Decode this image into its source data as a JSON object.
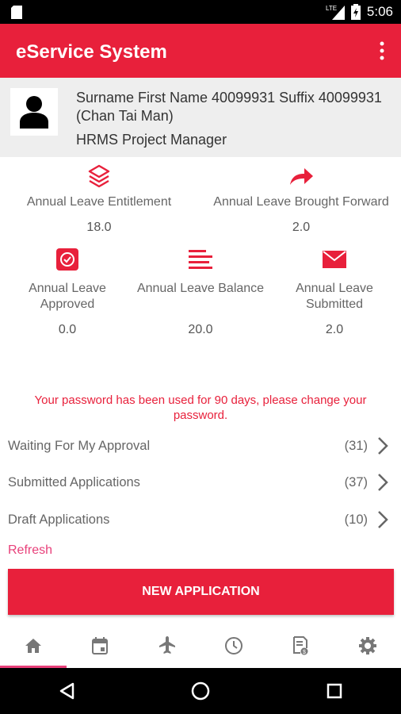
{
  "status_bar": {
    "time": "5:06",
    "network": "LTE"
  },
  "app_bar": {
    "title": "eService System"
  },
  "profile": {
    "name": "Surname First Name 40099931 Suffix 40099931 (Chan Tai Man)",
    "title": "HRMS Project Manager"
  },
  "stats": [
    {
      "label": "Annual Leave Entitlement",
      "value": "18.0",
      "icon": "layers-icon"
    },
    {
      "label": "Annual Leave Brought Forward",
      "value": "2.0",
      "icon": "forward-arrow-icon"
    },
    {
      "label": "Annual Leave Approved",
      "value": "0.0",
      "icon": "check-badge-icon"
    },
    {
      "label": "Annual Leave Balance",
      "value": "20.0",
      "icon": "lines-icon"
    },
    {
      "label": "Annual Leave Submitted",
      "value": "2.0",
      "icon": "envelope-icon"
    }
  ],
  "warning": "Your password has been used for 90 days, please change your password.",
  "lists": [
    {
      "label": "Waiting For My Approval",
      "count": "(31)"
    },
    {
      "label": "Submitted Applications",
      "count": "(37)"
    },
    {
      "label": "Draft Applications",
      "count": "(10)"
    }
  ],
  "refresh_label": "Refresh",
  "new_application_label": "NEW APPLICATION",
  "bottom_nav": [
    "home-icon",
    "calendar-icon",
    "airplane-icon",
    "clock-icon",
    "document-icon",
    "settings-icon"
  ],
  "colors": {
    "accent": "#e8203b",
    "pink": "#e8407a",
    "text": "#666666"
  }
}
